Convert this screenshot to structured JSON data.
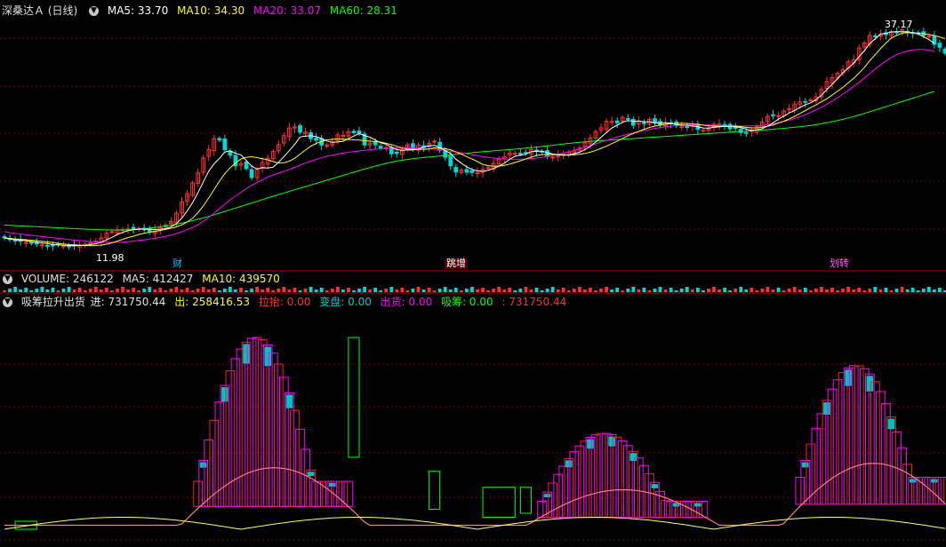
{
  "main_legend": {
    "title": "深桑达Ａ (日线)",
    "ma5": "MA5: 33.70",
    "ma10": "MA10: 34.30",
    "ma20": "MA20: 33.07",
    "ma60": "MA60: 28.31"
  },
  "volume_legend": {
    "label": "VOLUME: 246122",
    "ma5": "MA5: 412427",
    "ma10": "MA10: 439570"
  },
  "indicator_legend": {
    "name": "吸筹拉升出货",
    "in": "进: 731750.44",
    "out": "出: 258416.53",
    "lift": "拉抬: 0.00",
    "change": "变盘: 0.00",
    "ship": "出货: 0.00",
    "absorb": "吸筹: 0.00",
    "last": ": 731750.44"
  },
  "price_labels": {
    "high": "37.17",
    "low": "11.98"
  },
  "event_tags": [
    "财",
    "跳增",
    "划转"
  ],
  "colors": {
    "bg": "#000000",
    "up": "#ff3030",
    "down": "#00d8d8",
    "ma5": "#ffffff",
    "ma10": "#ffff00",
    "ma20": "#ff00ff",
    "ma60": "#00ff00",
    "grid": "#800000",
    "separator": "#b00000",
    "accumulate": "#ff00ff",
    "distribute": "#00c0c0",
    "red_box": "#ff2020",
    "green_box": "#00ff00"
  },
  "chart_data": [
    {
      "type": "candlestick",
      "title": "深桑达Ａ (日线)",
      "ylim": [
        10.5,
        38.5
      ],
      "x": [
        0,
        1,
        2,
        3,
        4,
        5,
        6,
        7,
        8,
        9,
        10,
        11,
        12,
        13,
        14,
        15,
        16,
        17,
        18,
        19,
        20,
        21,
        22,
        23,
        24,
        25,
        26,
        27,
        28,
        29,
        30,
        31,
        32,
        33,
        34,
        35,
        36,
        37,
        38,
        39,
        40,
        41,
        42,
        43,
        44,
        45,
        46,
        47,
        48,
        49,
        50,
        51,
        52,
        53,
        54,
        55,
        56,
        57,
        58,
        59,
        60,
        61,
        62,
        63,
        64,
        65,
        66,
        67,
        68,
        69,
        70,
        71,
        72,
        73,
        74,
        75,
        76,
        77,
        78,
        79,
        80,
        81,
        82,
        83,
        84,
        85,
        86,
        87,
        88,
        89,
        90,
        91,
        92,
        93,
        94,
        95,
        96,
        97,
        98,
        99,
        100,
        101,
        102,
        103,
        104,
        105,
        106,
        107,
        108,
        109,
        110,
        111,
        112,
        113,
        114,
        115,
        116,
        117,
        118,
        119,
        120,
        121,
        122,
        123,
        124,
        125,
        126,
        127,
        128,
        129,
        130,
        131,
        132,
        133,
        134,
        135,
        136,
        137,
        138,
        139,
        140,
        141,
        142,
        143,
        144,
        145,
        146,
        147,
        148,
        149,
        150,
        151,
        152,
        153,
        154,
        155,
        156,
        157,
        158,
        159,
        160,
        161,
        162,
        163,
        164,
        165,
        166,
        167,
        168,
        169,
        170,
        171,
        172,
        173,
        174,
        175
      ],
      "close": [
        12.9,
        12.72,
        12.55,
        12.52,
        12.4,
        12.3,
        12.22,
        12.12,
        12.05,
        12.02,
        12.1,
        12.0,
        11.99,
        12.06,
        12.1,
        12.2,
        12.35,
        12.55,
        12.9,
        13.45,
        13.61,
        13.79,
        13.83,
        13.92,
        13.95,
        13.99,
        13.82,
        13.64,
        13.86,
        14.08,
        14.35,
        14.77,
        15.7,
        16.95,
        17.9,
        19.11,
        20.24,
        21.92,
        22.86,
        24.1,
        23.93,
        22.84,
        22.24,
        21.02,
        21.28,
        20.71,
        19.7,
        20.61,
        21.41,
        21.89,
        22.66,
        23.42,
        24.42,
        25.29,
        25.42,
        24.81,
        24.82,
        24.08,
        23.91,
        23.36,
        23.38,
        23.71,
        24.51,
        24.45,
        24.86,
        24.76,
        24.72,
        23.37,
        23.57,
        23.4,
        23.01,
        23.07,
        22.38,
        22.43,
        22.87,
        23.4,
        22.96,
        23.34,
        23.09,
        23.56,
        23.79,
        22.79,
        21.99,
        21.03,
        20.33,
        20.56,
        20.3,
        20.27,
        20.28,
        20.63,
        20.81,
        21.32,
        21.78,
        22.05,
        22.46,
        22.43,
        22.42,
        22.54,
        22.85,
        22.62,
        22.56,
        22.08,
        22.02,
        22.2,
        22.36,
        22.56,
        22.72,
        23.03,
        23.63,
        24.16,
        24.88,
        25.31,
        26.03,
        26.02,
        25.87,
        26.48,
        26.26,
        25.6,
        26.06,
        25.77,
        26.26,
        25.85,
        25.64,
        25.88,
        25.86,
        25.53,
        25.51,
        25.39,
        25.54,
        25.13,
        25.03,
        25.2,
        25.71,
        25.74,
        25.63,
        25.18,
        25.26,
        24.78,
        24.76,
        24.98,
        25.46,
        25.94,
        26.59,
        26.74,
        26.68,
        27.21,
        27.49,
        27.98,
        28.21,
        28.17,
        28.47,
        28.79,
        29.63,
        30.51,
        30.96,
        31.44,
        31.84,
        32.73,
        32.97,
        34.28,
        34.87,
        35.71,
        35.59,
        35.82,
        35.81,
        36.13,
        36.0,
        36.34,
        36.08,
        35.95,
        35.94,
        35.69,
        35.64,
        34.71,
        34.36,
        33.7
      ],
      "ma5": [
        12.9,
        12.8,
        12.7,
        12.65,
        12.6,
        12.5,
        12.43,
        12.34,
        12.27,
        12.18,
        12.12,
        12.08,
        12.05,
        12.03,
        12.05,
        12.07,
        12.15,
        12.25,
        12.42,
        12.69,
        12.97,
        13.3,
        13.53,
        13.72,
        13.82,
        13.9,
        13.9,
        13.87,
        13.85,
        13.88,
        13.95,
        14.14,
        14.53,
        15.15,
        15.94,
        16.88,
        17.98,
        19.22,
        20.41,
        21.25,
        21.86,
        22.58,
        22.72,
        22.43,
        22.26,
        21.62,
        20.99,
        20.66,
        20.82,
        20.78,
        20.88,
        21.44,
        22.07,
        22.73,
        23.44,
        24.27,
        24.38,
        24.41,
        24.31,
        24.1,
        23.82,
        23.67,
        23.71,
        23.79,
        24.08,
        24.38,
        24.66,
        24.43,
        24.25,
        23.93,
        23.61,
        23.48,
        23.09,
        22.86,
        22.75,
        22.83,
        22.81,
        22.91,
        23.13,
        23.29,
        23.32,
        23.1,
        22.74,
        22.43,
        21.78,
        21.33,
        20.9,
        20.62,
        20.45,
        20.41,
        20.51,
        20.73,
        21.0,
        21.32,
        21.76,
        22.1,
        22.23,
        22.33,
        22.62,
        22.69,
        22.68,
        22.51,
        22.37,
        22.26,
        22.21,
        22.26,
        22.39,
        22.56,
        22.86,
        23.21,
        23.71,
        24.24,
        24.78,
        25.28,
        25.6,
        25.93,
        26.13,
        26.04,
        26.07,
        25.99,
        25.99,
        25.87,
        25.81,
        25.87,
        25.81,
        25.67,
        25.62,
        25.6,
        25.54,
        25.42,
        25.29,
        25.27,
        25.38,
        25.41,
        25.49,
        25.48,
        25.43,
        25.34,
        25.15,
        25.02,
        25.07,
        25.22,
        25.51,
        25.87,
        26.28,
        26.6,
        26.98,
        27.25,
        27.6,
        27.91,
        28.12,
        28.48,
        28.98,
        29.61,
        30.2,
        30.84,
        31.51,
        32.04,
        32.59,
        33.31,
        34.0,
        34.82,
        35.33,
        35.87,
        35.95,
        36.1,
        36.12,
        36.13,
        36.1,
        36.03,
        35.88,
        35.56,
        35.25,
        34.82
      ],
      "ma10": [
        12.9,
        12.85,
        12.78,
        12.75,
        12.7,
        12.65,
        12.6,
        12.52,
        12.45,
        12.4,
        12.3,
        12.23,
        12.16,
        12.12,
        12.09,
        12.05,
        12.04,
        12.05,
        12.1,
        12.2,
        12.35,
        12.55,
        12.75,
        12.95,
        13.1,
        13.3,
        13.42,
        13.55,
        13.65,
        13.74,
        13.88,
        14.0,
        14.15,
        14.38,
        14.7,
        15.12,
        15.75,
        16.5,
        17.4,
        18.35,
        19.3,
        20.15,
        20.8,
        21.35,
        21.8,
        21.98,
        22.05,
        21.95,
        21.83,
        21.7,
        21.5,
        21.35,
        21.38,
        21.55,
        21.88,
        22.35,
        22.8,
        23.25,
        23.55,
        23.75,
        23.95,
        24.0,
        24.06,
        24.04,
        24.0,
        23.95,
        23.94,
        23.85,
        23.8,
        23.76,
        23.7,
        23.56,
        23.42,
        23.23,
        23.03,
        22.93,
        22.89,
        22.89,
        22.87,
        22.93,
        23.05,
        23.02,
        22.96,
        22.84,
        22.59,
        22.33,
        22.06,
        21.79,
        21.5,
        21.19,
        21.04,
        20.99,
        21.0,
        21.08,
        21.22,
        21.4,
        21.6,
        21.8,
        22.0,
        22.2,
        22.29,
        22.33,
        22.31,
        22.3,
        22.25,
        22.26,
        22.29,
        22.33,
        22.42,
        22.56,
        22.77,
        22.99,
        23.24,
        23.53,
        23.81,
        24.11,
        24.42,
        24.67,
        24.9,
        25.14,
        25.35,
        25.5,
        25.6,
        25.7,
        25.78,
        25.79,
        25.82,
        25.8,
        25.75,
        25.69,
        25.61,
        25.53,
        25.51,
        25.49,
        25.48,
        25.47,
        25.49,
        25.44,
        25.35,
        25.3,
        25.3,
        25.38,
        25.49,
        25.62,
        25.85,
        26.05,
        26.3,
        26.6,
        26.92,
        27.25,
        27.58,
        27.89,
        28.24,
        28.58,
        29.0,
        29.44,
        29.86,
        30.37,
        30.88,
        31.47,
        32.12,
        32.87,
        33.54,
        34.24,
        34.86,
        35.41,
        35.72,
        35.96,
        36.02,
        36.0,
        35.96,
        35.9,
        35.81,
        35.7,
        35.53,
        35.35
      ],
      "ma20": [
        13.6,
        13.5,
        13.42,
        13.35,
        13.27,
        13.2,
        13.13,
        13.06,
        12.99,
        12.93,
        12.87,
        12.8,
        12.73,
        12.67,
        12.61,
        12.56,
        12.5,
        12.45,
        12.42,
        12.4,
        12.4,
        12.41,
        12.44,
        12.48,
        12.55,
        12.62,
        12.7,
        12.78,
        12.88,
        12.98,
        13.1,
        13.24,
        13.4,
        13.6,
        13.82,
        14.08,
        14.4,
        14.78,
        15.22,
        15.7,
        16.2,
        16.7,
        17.2,
        17.65,
        18.05,
        18.45,
        18.82,
        19.15,
        19.48,
        19.78,
        20.0,
        20.2,
        20.4,
        20.62,
        20.85,
        21.1,
        21.33,
        21.55,
        21.75,
        21.93,
        22.1,
        22.23,
        22.35,
        22.45,
        22.55,
        22.63,
        22.7,
        22.77,
        22.83,
        22.9,
        22.95,
        23.0,
        23.02,
        23.03,
        23.04,
        23.04,
        23.03,
        23.01,
        22.98,
        22.94,
        22.9,
        22.85,
        22.78,
        22.7,
        22.6,
        22.5,
        22.38,
        22.27,
        22.16,
        22.06,
        21.98,
        21.9,
        21.84,
        21.8,
        21.77,
        21.76,
        21.76,
        21.79,
        21.84,
        21.91,
        21.99,
        22.09,
        22.2,
        22.32,
        22.46,
        22.6,
        22.76,
        22.93,
        23.11,
        23.3,
        23.5,
        23.7,
        23.89,
        24.08,
        24.26,
        24.43,
        24.59,
        24.74,
        24.88,
        25.01,
        25.13,
        25.24,
        25.34,
        25.43,
        25.5,
        25.56,
        25.6,
        25.63,
        25.64,
        25.64,
        25.63,
        25.61,
        25.59,
        25.57,
        25.55,
        25.53,
        25.52,
        25.51,
        25.51,
        25.52,
        25.54,
        25.59,
        25.66,
        25.75,
        25.87,
        26.01,
        26.17,
        26.35,
        26.56,
        26.79,
        27.05,
        27.33,
        27.63,
        27.96,
        28.32,
        28.7,
        29.1,
        29.52,
        29.97,
        30.44,
        30.92,
        31.42,
        31.92,
        32.41,
        32.84,
        33.22,
        33.53,
        33.78,
        33.96,
        34.08,
        34.13,
        34.12,
        34.05,
        33.94
      ],
      "ma60": [
        14.35,
        14.32,
        14.29,
        14.26,
        14.23,
        14.2,
        14.17,
        14.14,
        14.11,
        14.08,
        14.05,
        14.02,
        13.99,
        13.96,
        13.93,
        13.9,
        13.87,
        13.85,
        13.83,
        13.81,
        13.8,
        13.8,
        13.81,
        13.83,
        13.86,
        13.9,
        13.95,
        14.01,
        14.08,
        14.16,
        14.25,
        14.35,
        14.46,
        14.58,
        14.71,
        14.85,
        15.0,
        15.16,
        15.33,
        15.51,
        15.7,
        15.89,
        16.08,
        16.27,
        16.46,
        16.65,
        16.84,
        17.03,
        17.22,
        17.41,
        17.6,
        17.79,
        17.97,
        18.15,
        18.33,
        18.51,
        18.69,
        18.87,
        19.05,
        19.23,
        19.41,
        19.59,
        19.77,
        19.95,
        20.13,
        20.31,
        20.49,
        20.66,
        20.83,
        21.0,
        21.15,
        21.3,
        21.44,
        21.56,
        21.66,
        21.75,
        21.83,
        21.9,
        21.96,
        22.02,
        22.08,
        22.14,
        22.2,
        22.26,
        22.32,
        22.38,
        22.44,
        22.5,
        22.56,
        22.61,
        22.66,
        22.71,
        22.76,
        22.81,
        22.86,
        22.91,
        22.96,
        23.02,
        23.08,
        23.14,
        23.2,
        23.27,
        23.34,
        23.41,
        23.48,
        23.55,
        23.61,
        23.67,
        23.72,
        23.77,
        23.82,
        23.86,
        23.9,
        23.94,
        23.98,
        24.02,
        24.06,
        24.1,
        24.14,
        24.18,
        24.22,
        24.26,
        24.3,
        24.34,
        24.38,
        24.42,
        24.46,
        24.5,
        24.54,
        24.58,
        24.62,
        24.66,
        24.7,
        24.74,
        24.78,
        24.82,
        24.86,
        24.9,
        24.94,
        24.98,
        25.02,
        25.06,
        25.1,
        25.15,
        25.2,
        25.25,
        25.31,
        25.37,
        25.43,
        25.5,
        25.58,
        25.67,
        25.77,
        25.88,
        26.0,
        26.13,
        26.27,
        26.42,
        26.58,
        26.75,
        26.93,
        27.12,
        27.31,
        27.5,
        27.69,
        27.88,
        28.07,
        28.26,
        28.45,
        28.64,
        28.83,
        29.02,
        29.21,
        29.4
      ]
    },
    {
      "type": "bar",
      "title": "VOLUME",
      "series": [
        {
          "name": "VOLUME",
          "value": 246122
        },
        {
          "name": "MA5",
          "value": 412427
        },
        {
          "name": "MA10",
          "value": 439570
        }
      ]
    },
    {
      "type": "bar",
      "title": "吸筹拉升出货",
      "ylim": [
        0,
        100
      ],
      "accumulate_segments": [
        {
          "from": 36,
          "to": 64,
          "peak": 100,
          "base": 28
        },
        {
          "from": 100,
          "to": 130,
          "peak": 52,
          "base": 18
        },
        {
          "from": 148,
          "to": 175,
          "peak": 86,
          "base": 30
        }
      ],
      "green_boxes": [
        {
          "from": 2,
          "to": 6,
          "top": 8,
          "bottom": 4
        },
        {
          "from": 64,
          "to": 66,
          "top": 100,
          "bottom": 40
        },
        {
          "from": 79,
          "to": 81,
          "top": 33,
          "bottom": 14
        },
        {
          "from": 89,
          "to": 95,
          "top": 25,
          "bottom": 10
        },
        {
          "from": 96,
          "to": 98,
          "top": 25,
          "bottom": 12
        }
      ]
    }
  ]
}
